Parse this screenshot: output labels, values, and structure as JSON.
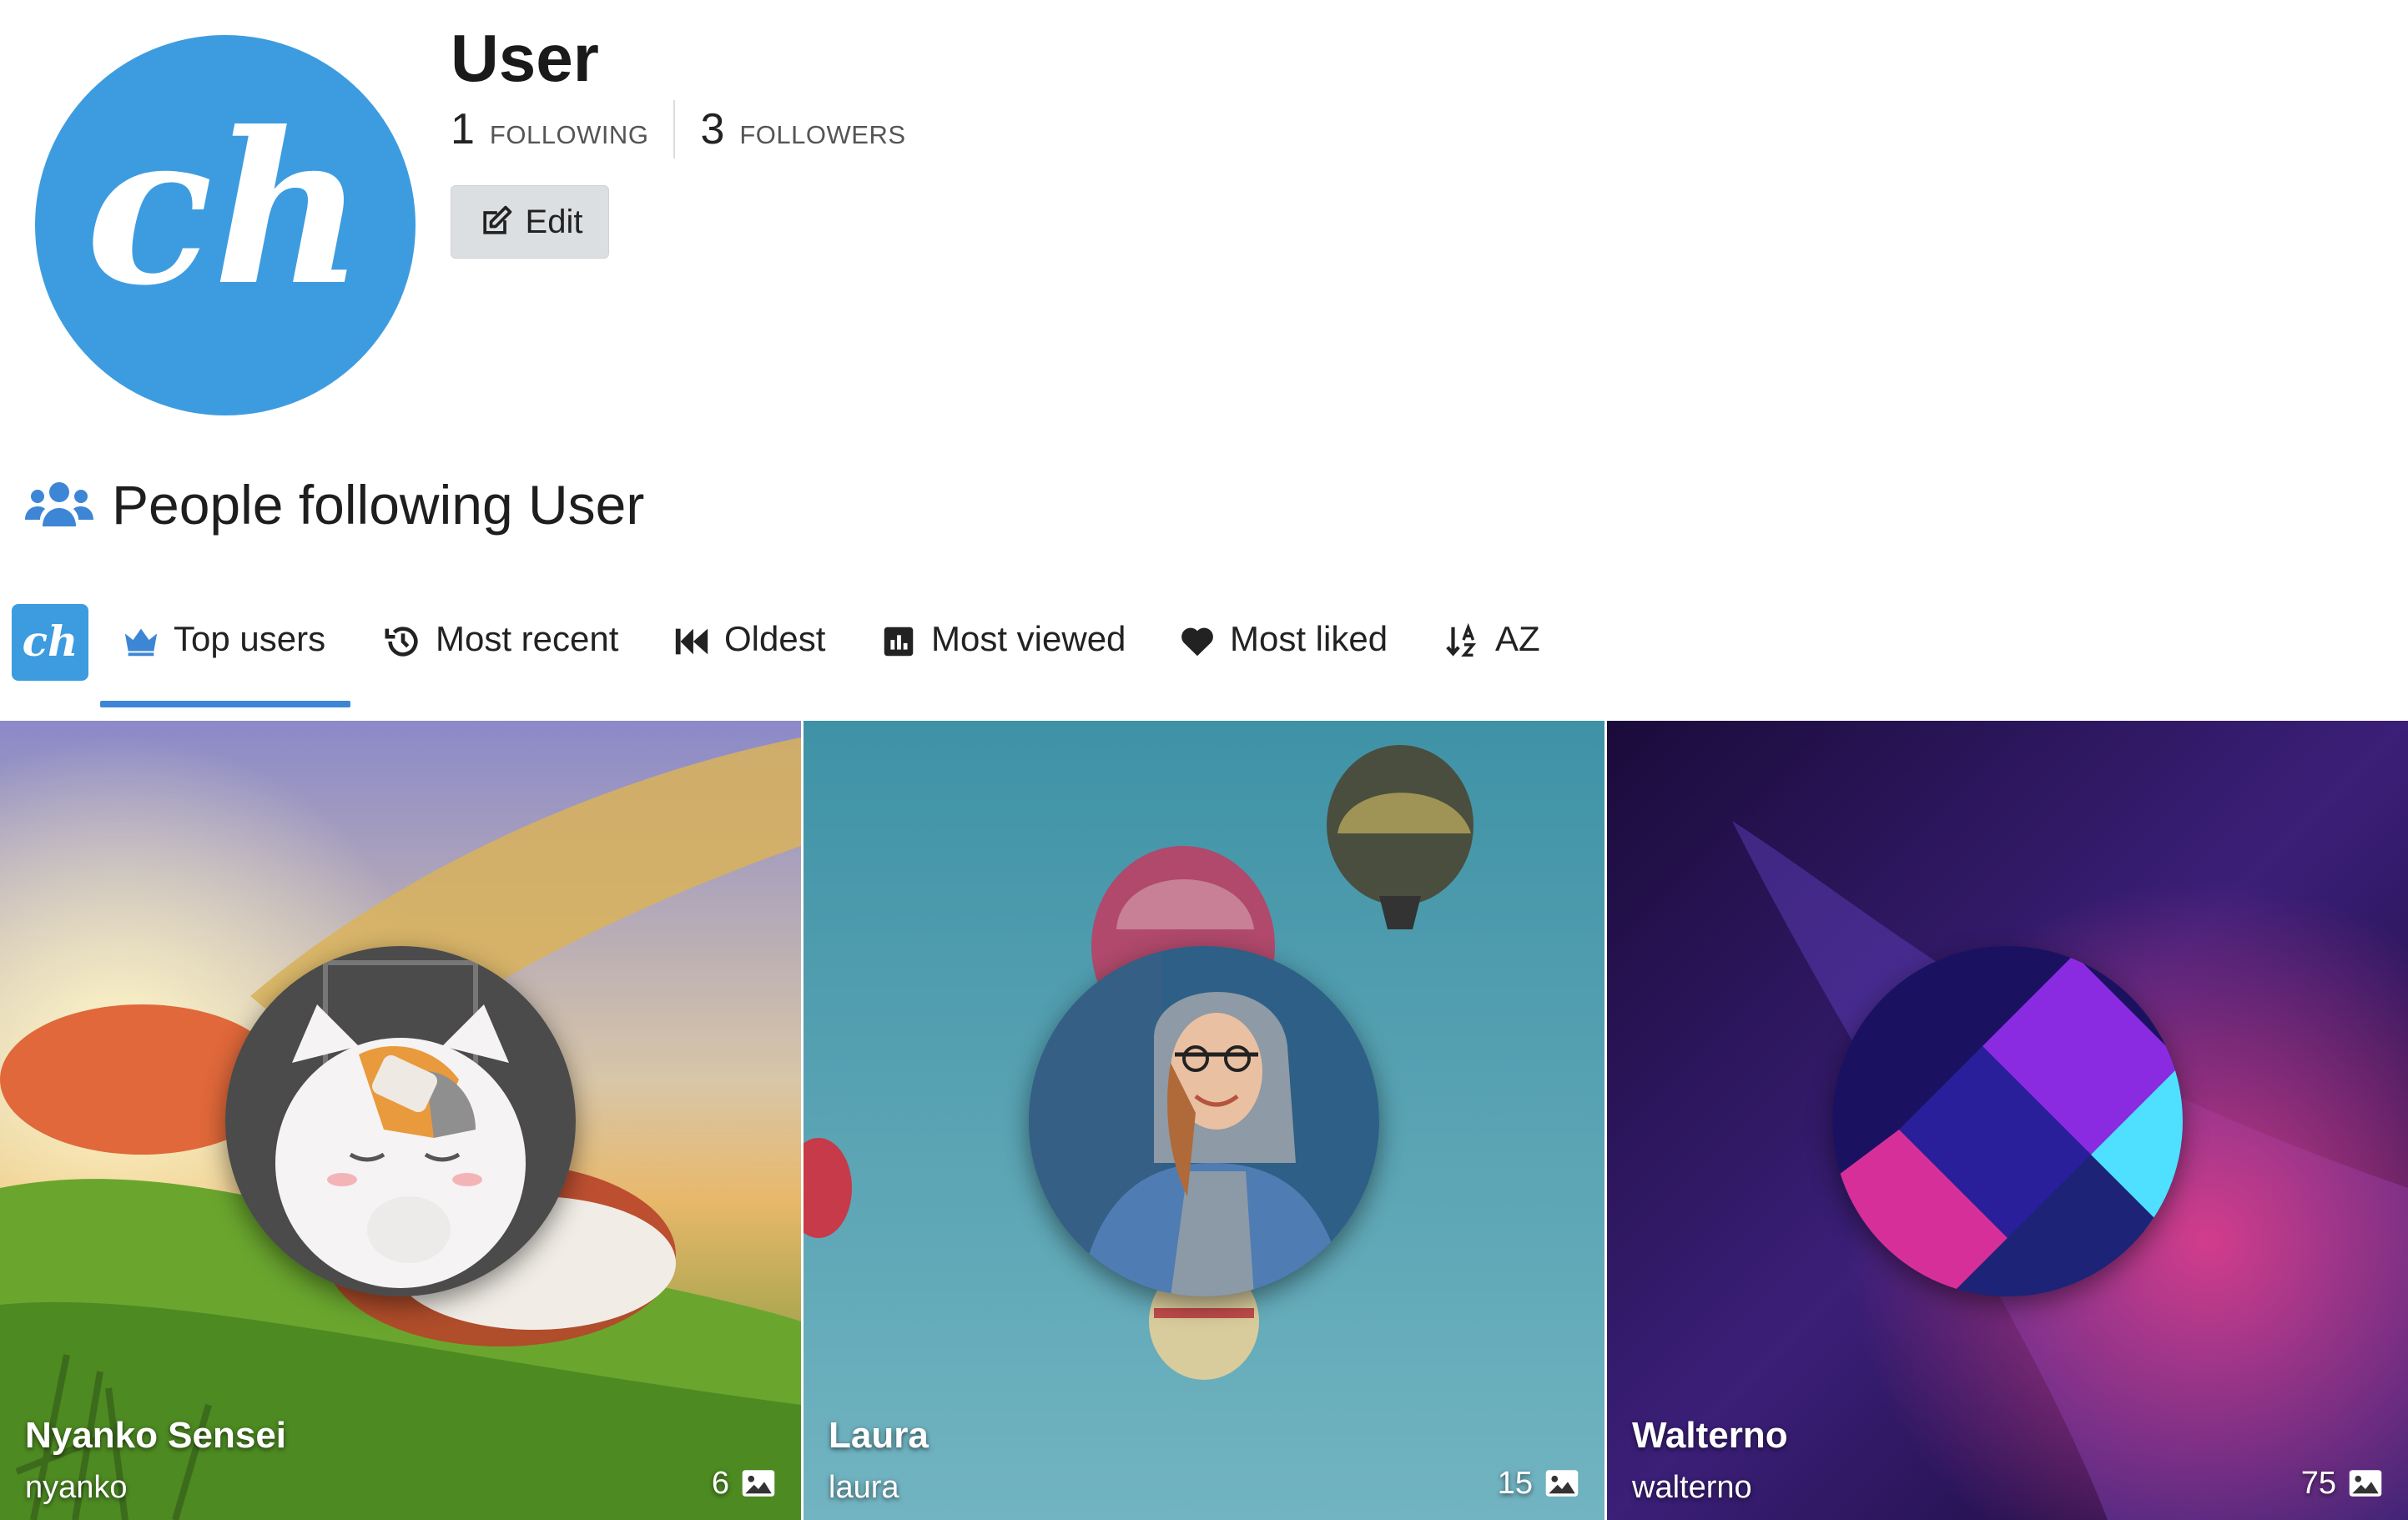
{
  "profile": {
    "name": "User",
    "following_count": "1",
    "following_label": "FOLLOWING",
    "followers_count": "3",
    "followers_label": "FOLLOWERS",
    "edit_label": "Edit",
    "avatar_text": "ch"
  },
  "section": {
    "title": "People following User",
    "icon": "users-icon"
  },
  "brand": {
    "text": "ch"
  },
  "tabs": [
    {
      "label": "Top users",
      "icon": "crown-icon",
      "active": true
    },
    {
      "label": "Most recent",
      "icon": "history-icon",
      "active": false
    },
    {
      "label": "Oldest",
      "icon": "fast-backward-icon",
      "active": false
    },
    {
      "label": "Most viewed",
      "icon": "chart-icon",
      "active": false
    },
    {
      "label": "Most liked",
      "icon": "heart-icon",
      "active": false
    },
    {
      "label": "AZ",
      "icon": "sort-alpha-icon",
      "active": false
    }
  ],
  "users": [
    {
      "name": "Nyanko Sensei",
      "username": "nyanko",
      "image_count": "6"
    },
    {
      "name": "Laura",
      "username": "laura",
      "image_count": "15"
    },
    {
      "name": "Walterno",
      "username": "walterno",
      "image_count": "75"
    }
  ],
  "colors": {
    "brand": "#3d9ce0",
    "tab_underline": "#3d86d6",
    "button_bg": "#dcdfe1"
  }
}
